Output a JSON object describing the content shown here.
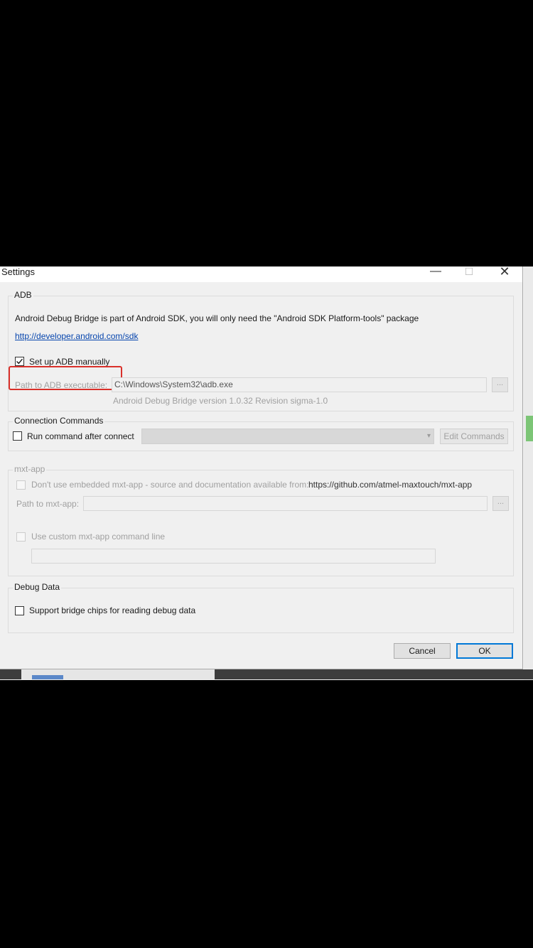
{
  "window": {
    "title": "Settings",
    "minimize": "—",
    "maximize": "☐",
    "close": "✕"
  },
  "adb": {
    "group_label": "ADB",
    "description": "Android Debug Bridge is part of Android SDK, you will only need the \"Android SDK Platform-tools\" package",
    "link": "http://developer.android.com/sdk",
    "manual_checkbox_label": "Set up ADB manually",
    "manual_checked": true,
    "path_label": "Path to ADB executable:",
    "path_value": "C:\\Windows\\System32\\adb.exe",
    "browse_label": "...",
    "version_text": "Android Debug Bridge version 1.0.32 Revision sigma-1.0"
  },
  "connection": {
    "group_label": "Connection Commands",
    "run_checkbox_label": "Run command after connect",
    "run_checked": false,
    "combo_arrow": "▾",
    "edit_button": "Edit Commands"
  },
  "mxt": {
    "group_label": "mxt-app",
    "embedded_label": "Don't use embedded mxt-app - source and documentation available from:",
    "embedded_url": "https://github.com/atmel-maxtouch/mxt-app",
    "path_label": "Path to mxt-app:",
    "browse_label": "...",
    "custom_label": "Use custom mxt-app command line"
  },
  "debug": {
    "group_label": "Debug Data",
    "bridge_label": "Support bridge chips for reading debug data",
    "bridge_checked": false
  },
  "buttons": {
    "cancel": "Cancel",
    "ok": "OK"
  },
  "colors": {
    "highlight": "#d9302a",
    "default_button_border": "#0078d7",
    "link": "#0645ad"
  }
}
